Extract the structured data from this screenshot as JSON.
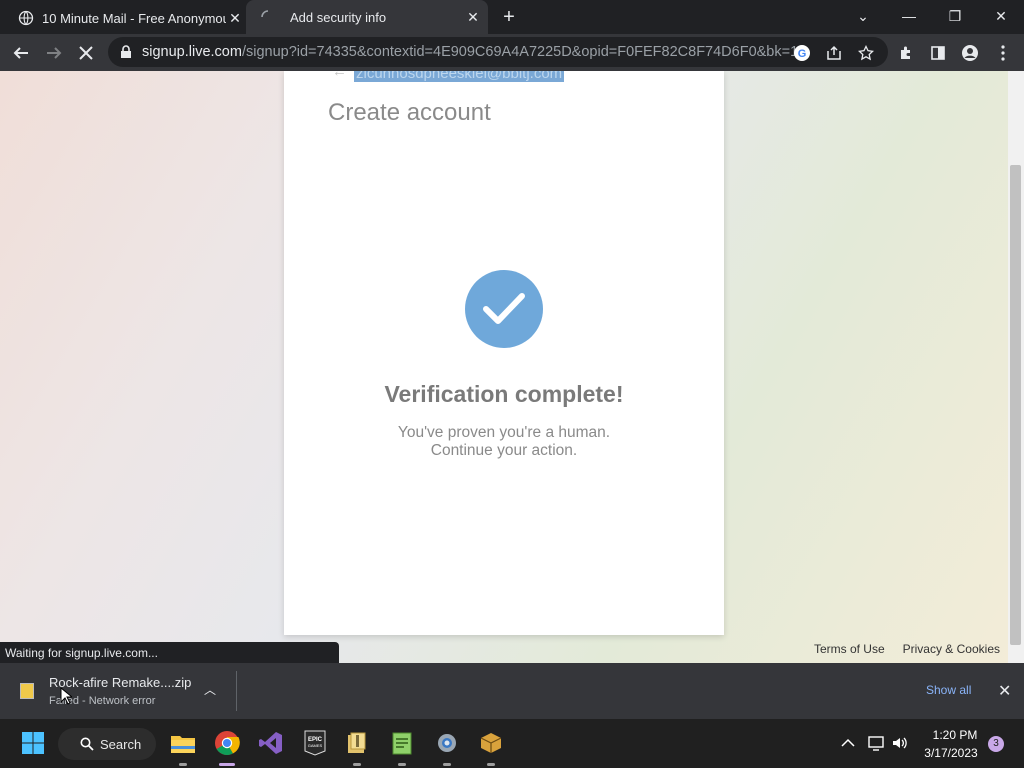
{
  "tabs": [
    {
      "title": "10 Minute Mail - Free Anonymou",
      "icon": "globe-icon"
    },
    {
      "title": "Add security info",
      "icon": "loading-spinner-icon"
    }
  ],
  "address_bar": {
    "host": "signup.live.com",
    "path": "/signup?id=74335&contextid=4E909C69A4A7225D&opid=F0FEF82C8F74D6F0&bk=1..."
  },
  "page": {
    "email": "zicunnosdpheeskiel@bbitj.com",
    "create_title": "Create account",
    "verify_title": "Verification complete!",
    "verify_line1": "You've proven you're a human.",
    "verify_line2": "Continue your action.",
    "footer": {
      "terms": "Terms of Use",
      "privacy": "Privacy & Cookies"
    },
    "accent": "#6fa8da"
  },
  "status_bar": "Waiting for signup.live.com...",
  "download": {
    "filename": "Rock-afire Remake....zip",
    "status": "Failed - Network error",
    "show_all": "Show all"
  },
  "taskbar": {
    "search_label": "Search",
    "time": "1:20 PM",
    "date": "3/17/2023",
    "notifications": "3"
  }
}
